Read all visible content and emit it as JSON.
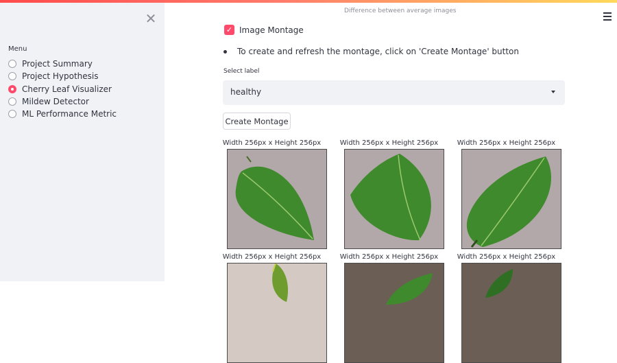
{
  "header": {
    "caption": "Difference between average images"
  },
  "sidebar": {
    "close_icon": "close-icon",
    "menu_title": "Menu",
    "items": [
      {
        "label": "Project Summary",
        "selected": false
      },
      {
        "label": "Project Hypothesis",
        "selected": false
      },
      {
        "label": "Cherry Leaf Visualizer",
        "selected": true
      },
      {
        "label": "Mildew Detector",
        "selected": false
      },
      {
        "label": "ML Performance Metric",
        "selected": false
      }
    ]
  },
  "main": {
    "checkbox_label": "Image Montage",
    "checkbox_checked": true,
    "bullet_text": "To create and refresh the montage, click on 'Create Montage' button",
    "select_label": "Select label",
    "select_value": "healthy",
    "button_label": "Create Montage",
    "montage": {
      "captions": [
        "Width 256px x Height 256px",
        "Width 256px x Height 256px",
        "Width 256px x Height 256px",
        "Width 256px x Height 256px",
        "Width 256px x Height 256px",
        "Width 256px x Height 256px"
      ]
    }
  },
  "colors": {
    "accent": "#ff4b6b",
    "sidebar_bg": "#f0f2f6",
    "leaf": "#3f8a2c",
    "background_surface": "#b3a8a9"
  }
}
